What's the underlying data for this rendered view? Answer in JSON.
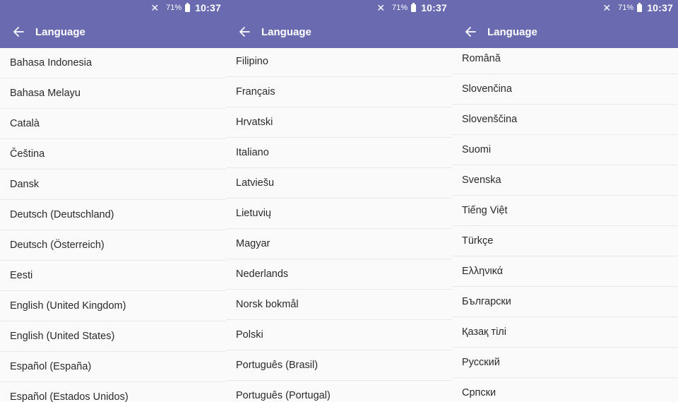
{
  "status_bar": {
    "battery": "71%",
    "time": "10:37"
  },
  "screens": [
    {
      "title": "Language",
      "items": [
        "Bahasa Indonesia",
        "Bahasa Melayu",
        "Català",
        "Čeština",
        "Dansk",
        "Deutsch (Deutschland)",
        "Deutsch (Österreich)",
        "Eesti",
        "English (United Kingdom)",
        "English (United States)",
        "Español (España)",
        "Español (Estados Unidos)"
      ]
    },
    {
      "title": "Language",
      "items": [
        "Filipino",
        "Français",
        "Hrvatski",
        "Italiano",
        "Latviešu",
        "Lietuvių",
        "Magyar",
        "Nederlands",
        "Norsk bokmål",
        "Polski",
        "Português (Brasil)",
        "Português (Portugal)"
      ]
    },
    {
      "title": "Language",
      "items": [
        "Română",
        "Slovenčina",
        "Slovenščina",
        "Suomi",
        "Svenska",
        "Tiếng Việt",
        "Türkçe",
        "Ελληνικά",
        "Български",
        "Қазақ тілі",
        "Русский",
        "Српски"
      ]
    }
  ]
}
